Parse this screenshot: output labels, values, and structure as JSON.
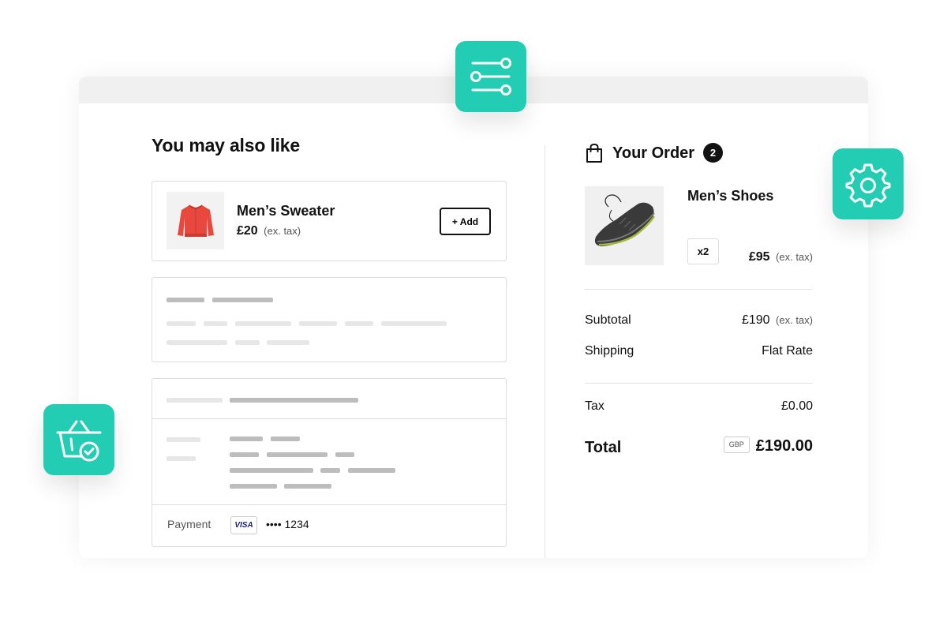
{
  "upsell": {
    "title": "You may also like",
    "product": {
      "name": "Men’s Sweater",
      "price": "£20",
      "tax_note": "(ex. tax)",
      "add_label": "+ Add"
    }
  },
  "payment": {
    "label": "Payment",
    "card_brand": "VISA",
    "card_number": "•••• 1234"
  },
  "order": {
    "title": "Your Order",
    "count": "2",
    "item": {
      "name": "Men’s Shoes",
      "quantity": "x2",
      "price": "£95",
      "tax_note": "(ex. tax)"
    },
    "subtotal_label": "Subtotal",
    "subtotal_value": "£190",
    "subtotal_tax_note": "(ex. tax)",
    "shipping_label": "Shipping",
    "shipping_value": "Flat Rate",
    "tax_label": "Tax",
    "tax_value": "£0.00",
    "total_label": "Total",
    "currency": "GBP",
    "total_value": "£190.00"
  },
  "icons": {
    "filters": "sliders-icon",
    "settings": "gear-icon",
    "basket": "basket-check-icon"
  },
  "colors": {
    "accent": "#22cdb3",
    "sweater": "#e8483d"
  }
}
